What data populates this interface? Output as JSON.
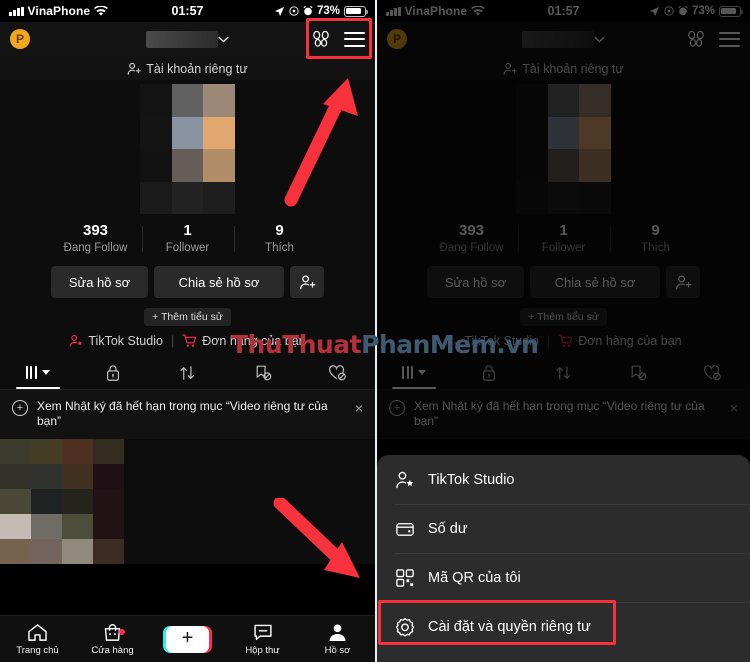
{
  "meta": {
    "accent_red": "#f8323c",
    "sheet_bg": "#2c2c2c",
    "tiktok_pink": "#fe2c55"
  },
  "status_bar": {
    "carrier": "VinaPhone",
    "time": "01:57",
    "battery": "73%"
  },
  "header": {
    "coin_label": "P",
    "username_masked": "",
    "chevron": "⌄",
    "friends_icon_label": "friends",
    "menu_icon_label": "menu"
  },
  "profile": {
    "privacy_label": "Tài khoản riêng tư",
    "stats": [
      {
        "num": "393",
        "label": "Đang Follow"
      },
      {
        "num": "1",
        "label": "Follower"
      },
      {
        "num": "9",
        "label": "Thích"
      }
    ],
    "edit_profile": "Sửa hồ sơ",
    "share_profile": "Chia sẻ hồ sơ",
    "add_bio": "+ Thêm tiểu sử",
    "studio": "TikTok Studio",
    "orders": "Đơn hàng của bạn",
    "separator": "|"
  },
  "tabs": [
    {
      "name": "videos",
      "icon": "grid-icon",
      "active": true
    },
    {
      "name": "private",
      "icon": "lock-icon",
      "active": false
    },
    {
      "name": "reposts",
      "icon": "repost-icon",
      "active": false
    },
    {
      "name": "saved",
      "icon": "bookmark-off-icon",
      "active": false
    },
    {
      "name": "liked",
      "icon": "heart-off-icon",
      "active": false
    }
  ],
  "banner": {
    "icon": "plus-circle-icon",
    "text": "Xem Nhật ký đã hết hạn trong mục “Video riêng tư của bạn”",
    "close": "×"
  },
  "bottom_nav": [
    {
      "label": "Trang chủ",
      "icon": "home-icon"
    },
    {
      "label": "Cửa hàng",
      "icon": "shop-icon",
      "badge": true
    },
    {
      "label": "",
      "icon": "create-plus-icon"
    },
    {
      "label": "Hộp thư",
      "icon": "inbox-icon"
    },
    {
      "label": "Hồ sơ",
      "icon": "profile-icon"
    }
  ],
  "sheet": {
    "items": [
      {
        "label": "TikTok Studio",
        "icon": "person-star-icon",
        "highlighted": false
      },
      {
        "label": "Số dư",
        "icon": "wallet-icon",
        "highlighted": false
      },
      {
        "label": "Mã QR của tôi",
        "icon": "qr-icon",
        "highlighted": false
      },
      {
        "label": "Cài đặt và quyền riêng tư",
        "icon": "gear-icon",
        "highlighted": true
      }
    ]
  },
  "watermark": {
    "part1": "ThuThuat",
    "part2": "PhanMem.vn"
  }
}
